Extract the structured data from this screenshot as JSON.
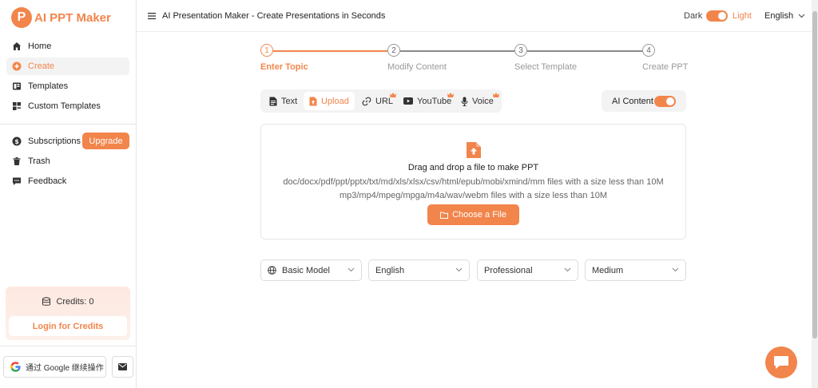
{
  "app": {
    "logo_letter": "P",
    "logo_text": "AI PPT Maker",
    "accent_color": "#f2854b"
  },
  "sidebar": {
    "items": [
      {
        "label": "Home",
        "icon": "home-icon"
      },
      {
        "label": "Create",
        "icon": "plus-circle-icon",
        "active": true
      },
      {
        "label": "Templates",
        "icon": "templates-icon"
      },
      {
        "label": "Custom Templates",
        "icon": "custom-templates-icon"
      }
    ],
    "secondary": [
      {
        "label": "Subscriptions",
        "icon": "dollar-icon"
      },
      {
        "label": "Trash",
        "icon": "trash-icon"
      },
      {
        "label": "Feedback",
        "icon": "feedback-icon"
      }
    ],
    "upgrade_label": "Upgrade",
    "credits_label": "Credits: 0",
    "login_label": "Login for Credits",
    "google_label": "通过 Google 继续操作"
  },
  "header": {
    "title": "AI Presentation Maker - Create Presentations in Seconds",
    "theme_dark": "Dark",
    "theme_light": "Light",
    "language": "English"
  },
  "stepper": {
    "steps": [
      {
        "number": "1",
        "label": "Enter Topic",
        "active": true
      },
      {
        "number": "2",
        "label": "Modify Content"
      },
      {
        "number": "3",
        "label": "Select Template"
      },
      {
        "number": "4",
        "label": "Create PPT"
      }
    ]
  },
  "source_tabs": [
    {
      "label": "Text",
      "icon": "text-doc-icon"
    },
    {
      "label": "Upload",
      "icon": "upload-file-icon",
      "active": true
    },
    {
      "label": "URL",
      "icon": "link-icon",
      "premium": true
    },
    {
      "label": "YouTube",
      "icon": "youtube-icon",
      "premium": true
    },
    {
      "label": "Voice",
      "icon": "microphone-icon",
      "premium": true
    }
  ],
  "ai_content": {
    "label": "AI Content",
    "enabled": true
  },
  "dropzone": {
    "title": "Drag and drop a file to make PPT",
    "line1": "doc/docx/pdf/ppt/pptx/txt/md/xls/xlsx/csv/html/epub/mobi/xmind/mm files with a size less than 10M",
    "line2": "mp3/mp4/mpeg/mpga/m4a/wav/webm files with a size less than 10M",
    "button_label": "Choose a File"
  },
  "selects": {
    "model": "Basic Model",
    "language": "English",
    "tone": "Professional",
    "length": "Medium"
  }
}
